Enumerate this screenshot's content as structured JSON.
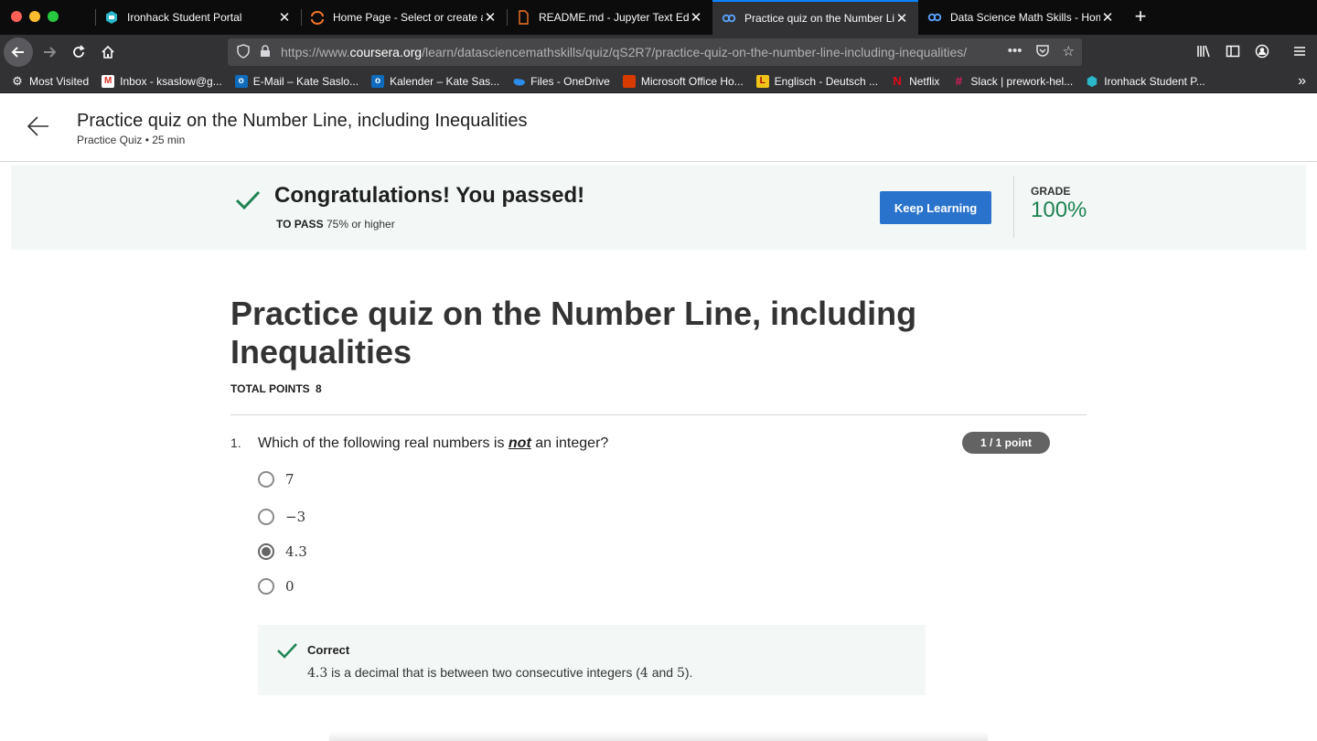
{
  "browser": {
    "tabs": [
      {
        "title": "Ironhack Student Portal",
        "icon": "ironhack-icon"
      },
      {
        "title": "Home Page - Select or create a",
        "icon": "jupyter-icon"
      },
      {
        "title": "README.md - Jupyter Text Edit",
        "icon": "file-icon"
      },
      {
        "title": "Practice quiz on the Number Li",
        "icon": "coursera-icon",
        "active": true
      },
      {
        "title": "Data Science Math Skills - Hom",
        "icon": "coursera-icon"
      }
    ],
    "url_prefix": "https://www.",
    "url_domain": "coursera.org",
    "url_path": "/learn/datasciencemathskills/quiz/qS2R7/practice-quiz-on-the-number-line-including-inequalities/",
    "bookmarks": [
      {
        "label": "Most Visited",
        "icon": "gear-icon"
      },
      {
        "label": "Inbox - ksaslow@g...",
        "icon": "gmail-icon"
      },
      {
        "label": "E-Mail – Kate Saslo...",
        "icon": "outlook-icon"
      },
      {
        "label": "Kalender – Kate Sas...",
        "icon": "outlook-icon"
      },
      {
        "label": "Files - OneDrive",
        "icon": "onedrive-icon"
      },
      {
        "label": "Microsoft Office Ho...",
        "icon": "office-icon"
      },
      {
        "label": "Englisch - Deutsch ...",
        "icon": "dictionary-icon"
      },
      {
        "label": "Netflix",
        "icon": "netflix-icon"
      },
      {
        "label": "Slack | prework-hel...",
        "icon": "slack-icon"
      },
      {
        "label": "Ironhack Student P...",
        "icon": "ironhack-icon"
      }
    ]
  },
  "header": {
    "title": "Practice quiz on the Number Line, including Inequalities",
    "subtitle": "Practice Quiz • 25 min"
  },
  "banner": {
    "message": "Congratulations! You passed!",
    "to_pass_label": "TO PASS",
    "to_pass_value": "75% or higher",
    "button_label": "Keep Learning",
    "grade_label": "GRADE",
    "grade_value": "100%"
  },
  "quiz": {
    "title": "Practice quiz on the Number Line, including Inequalities",
    "total_points_label": "TOTAL POINTS",
    "total_points_value": "8",
    "question": {
      "number": "1.",
      "text_before": "Which of the following real numbers is",
      "text_emph": "not",
      "text_after": "an integer?",
      "points": "1 / 1 point",
      "options": [
        "7",
        "−3",
        "4.3",
        "0"
      ],
      "selected_index": 2,
      "feedback_label": "Correct",
      "feedback_value": "4.3",
      "feedback_text_1": "is a decimal that is between two consecutive integers (",
      "feedback_num_a": "4",
      "feedback_text_2": "and",
      "feedback_num_b": "5",
      "feedback_text_3": ")."
    }
  },
  "colors": {
    "accent": "#2a73cc",
    "success": "#1f8354",
    "banner_bg": "#f3f8f6"
  }
}
